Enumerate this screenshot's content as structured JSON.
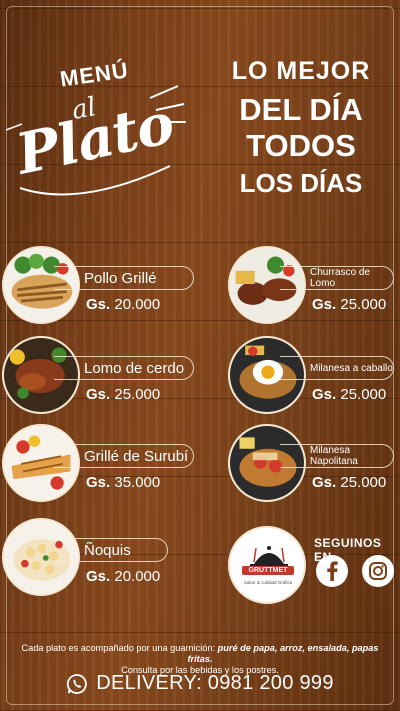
{
  "logo": {
    "menu": "MENÚ",
    "al": "al",
    "plato": "Plato"
  },
  "headline": {
    "line1": "LO MEJOR",
    "line2": "DEL DÍA",
    "line3": "TODOS",
    "line4": "LOS DÍAS"
  },
  "items": [
    {
      "name": "Pollo Grillé",
      "currency": "Gs.",
      "price": "20.000"
    },
    {
      "name": "Churrasco de Lomo",
      "currency": "Gs.",
      "price": "25.000"
    },
    {
      "name": "Lomo de cerdo",
      "currency": "Gs.",
      "price": "25.000"
    },
    {
      "name": "Milanesa a caballo",
      "currency": "Gs.",
      "price": "25.000"
    },
    {
      "name": "Grillé de Surubí",
      "currency": "Gs.",
      "price": "35.000"
    },
    {
      "name": "Milanesa Napolitana",
      "currency": "Gs.",
      "price": "25.000"
    },
    {
      "name": "Ñoquis",
      "currency": "Gs.",
      "price": "20.000"
    }
  ],
  "brand": {
    "name": "GRUTTMET",
    "tagline": "Sabor & Calidad Gráfica"
  },
  "social": {
    "follow": "SEGUINOS EN",
    "facebook_icon": "facebook-icon",
    "instagram_icon": "instagram-icon"
  },
  "footnote": {
    "part1": "Cada plato es acompañado por una guarnición:",
    "part2": "puré de papa, arroz, ensalada, papas fritas.",
    "line2": "Consulta por las bebidas y los postres."
  },
  "delivery": {
    "label": "DELIVERY: 0981 200 999",
    "icon": "whatsapp-icon"
  },
  "colors": {
    "wood": "#7a4019",
    "accent": "#c0392b",
    "text": "#ffffff"
  }
}
